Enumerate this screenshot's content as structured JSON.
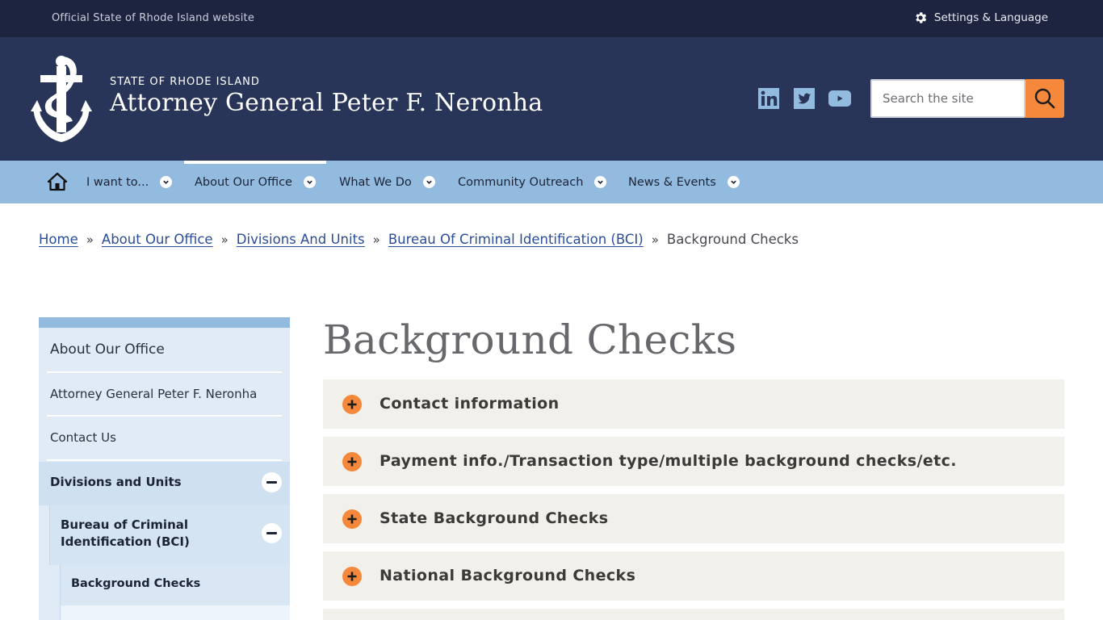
{
  "utility_bar": {
    "official_text": "Official State of Rhode Island website",
    "settings_label": "Settings & Language"
  },
  "header": {
    "state_label": "STATE OF RHODE ISLAND",
    "site_title": "Attorney General Peter F. Neronha",
    "social": [
      "linkedin-icon",
      "twitter-icon",
      "youtube-icon"
    ],
    "search_placeholder": "Search the site",
    "colors": {
      "header_bg": "#283558",
      "utility_bg": "#1d2440",
      "accent": "#f6883b",
      "nav_bg": "#93bbe0"
    }
  },
  "nav": {
    "items": [
      {
        "label": "I want to..."
      },
      {
        "label": "About Our Office",
        "active": true
      },
      {
        "label": "What We Do"
      },
      {
        "label": "Community Outreach"
      },
      {
        "label": "News & Events"
      }
    ]
  },
  "breadcrumb": {
    "links": [
      "Home",
      "About Our Office",
      "Divisions And Units",
      "Bureau Of Criminal Identification (BCI)"
    ],
    "separator": "»",
    "current": "Background Checks"
  },
  "sidebar": {
    "items": [
      {
        "label": "About Our Office"
      },
      {
        "label": "Attorney General Peter F. Neronha"
      },
      {
        "label": "Contact Us"
      },
      {
        "label": "Divisions and Units",
        "expanded": true
      },
      {
        "label_line1": "Bureau of Criminal",
        "label_line2": "Identification (BCI)",
        "expanded": true
      },
      {
        "label": "Background Checks",
        "current": true
      }
    ]
  },
  "main": {
    "title": "Background Checks",
    "accordions": [
      {
        "label": "Contact information"
      },
      {
        "label": "Payment info./Transaction type/multiple background checks/etc."
      },
      {
        "label": "State Background Checks"
      },
      {
        "label": "National Background Checks"
      }
    ]
  }
}
